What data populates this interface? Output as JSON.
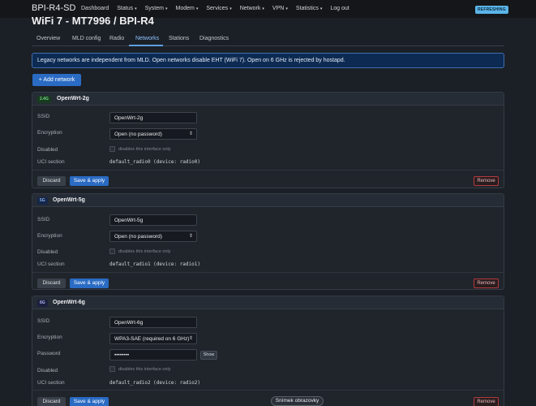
{
  "header": {
    "brand": "BPI-R4-SD",
    "menu": [
      {
        "label": "Dashboard",
        "has_caret": false
      },
      {
        "label": "Status",
        "has_caret": true
      },
      {
        "label": "System",
        "has_caret": true
      },
      {
        "label": "Modem",
        "has_caret": true
      },
      {
        "label": "Services",
        "has_caret": true
      },
      {
        "label": "Network",
        "has_caret": true
      },
      {
        "label": "VPN",
        "has_caret": true
      },
      {
        "label": "Statistics",
        "has_caret": true
      },
      {
        "label": "Log out",
        "has_caret": false
      }
    ],
    "refresh_badge": "REFRESHING",
    "caret_glyph": "▾"
  },
  "page_title": "WiFi 7 - MT7996 / BPI-R4",
  "tabs": {
    "overview": "Overview",
    "mld": "MLD config",
    "radio": "Radio",
    "networks": "Networks",
    "stations": "Stations",
    "diagnostics": "Diagnostics",
    "active": "Networks"
  },
  "notice": "Legacy networks are independent from MLD. Open networks disable EHT (WiFi 7). Open on 6 GHz is rejected by hostapd.",
  "add_network_label": "+ Add network",
  "labels": {
    "ssid": "SSID",
    "encryption": "Encryption",
    "password": "Password",
    "disabled": "Disabled",
    "uci_section": "UCI section",
    "disabled_hint": "disables this interface only",
    "discard": "Discard",
    "save_apply": "Save & apply",
    "remove": "Remove",
    "show": "Show"
  },
  "networks": [
    {
      "band": "2.4G",
      "name": "OpenWrt-2g",
      "ssid": "OpenWrt-2g",
      "encryption": "Open (no password)",
      "uci": "default_radio0 (device: radio0)"
    },
    {
      "band": "5G",
      "name": "OpenWrt-5g",
      "ssid": "OpenWrt-5g",
      "encryption": "Open (no password)",
      "uci": "default_radio1 (device: radio1)"
    },
    {
      "band": "6G",
      "name": "OpenWrt-6g",
      "ssid": "OpenWrt-6g",
      "encryption": "WPA3-SAE (required on 6 GHz)",
      "password": "••••••••",
      "uci": "default_radio2 (device: radio2)"
    }
  ],
  "tooltip": "Snímek obrazovky",
  "colors": {
    "accent": "#2a6bc4",
    "remove": "#b23a3e",
    "badge": "#5ab4e8"
  }
}
